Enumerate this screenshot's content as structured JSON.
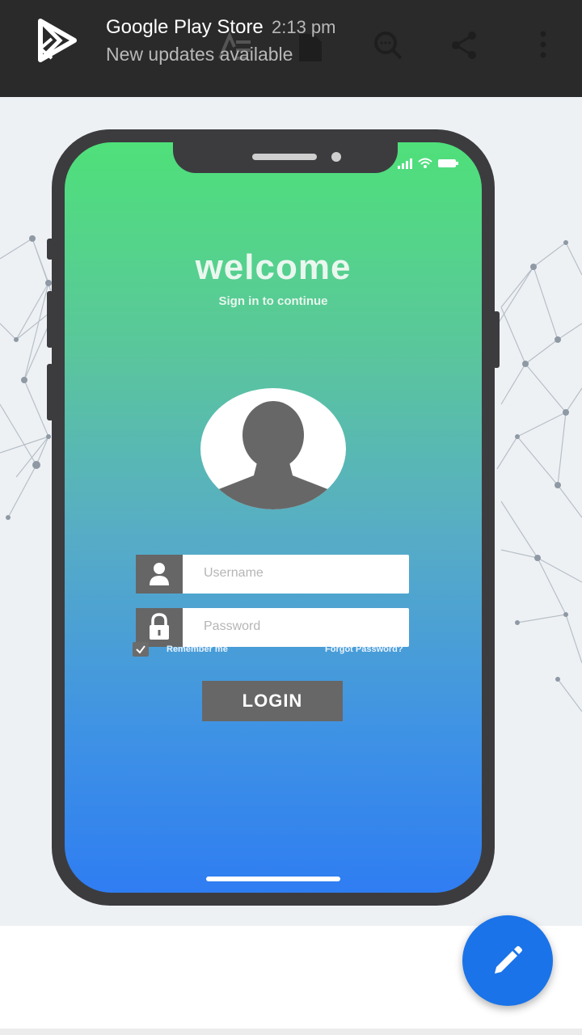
{
  "notification": {
    "app_name": "Google Play Store",
    "time": "2:13 pm",
    "message": "New updates available",
    "icon": "play-store-icon"
  },
  "toolbar": {
    "icons": [
      "back-arrow-icon",
      "text-format-icon",
      "document-icon",
      "search-icon",
      "share-icon",
      "more-vert-icon"
    ]
  },
  "mockup": {
    "title": "welcome",
    "subtitle": "Sign in to continue",
    "username_placeholder": "Username",
    "password_placeholder": "Password",
    "remember_label": "Remember me",
    "forgot_label": "Forgot Password?",
    "login_label": "LOGIN"
  },
  "fab": {
    "icon": "edit-pencil-icon"
  },
  "colors": {
    "toolbar_bg": "#2a2a2a",
    "gradient_top": "#4fe07a",
    "gradient_bottom": "#2f7df2",
    "fab": "#1a73e8",
    "phone_frame": "#3c3c3f"
  }
}
